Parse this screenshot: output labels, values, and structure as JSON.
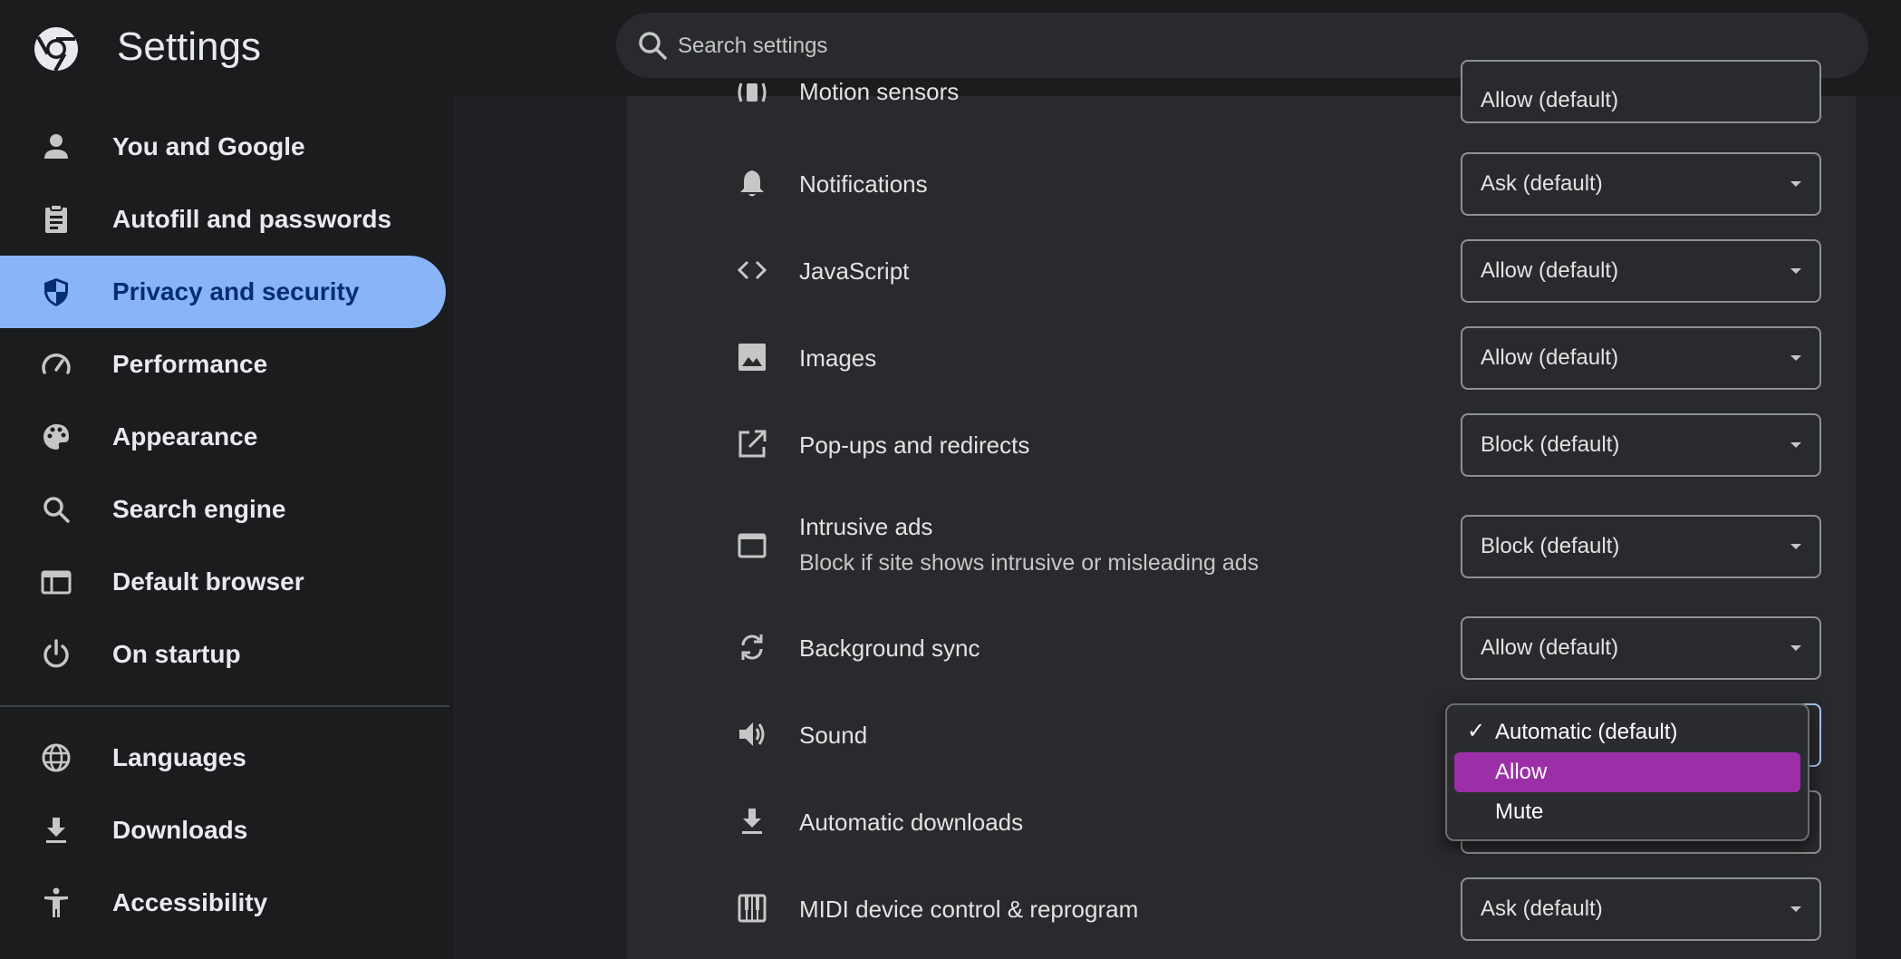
{
  "header": {
    "title": "Settings",
    "search_placeholder": "Search settings"
  },
  "sidebar": {
    "items": [
      {
        "label": "You and Google",
        "icon": "person-icon"
      },
      {
        "label": "Autofill and passwords",
        "icon": "clipboard-icon"
      },
      {
        "label": "Privacy and security",
        "icon": "shield-icon",
        "active": true
      },
      {
        "label": "Performance",
        "icon": "speedometer-icon"
      },
      {
        "label": "Appearance",
        "icon": "palette-icon"
      },
      {
        "label": "Search engine",
        "icon": "search-icon"
      },
      {
        "label": "Default browser",
        "icon": "browser-window-icon"
      },
      {
        "label": "On startup",
        "icon": "power-icon"
      },
      {
        "label": "Languages",
        "icon": "globe-icon"
      },
      {
        "label": "Downloads",
        "icon": "download-icon"
      },
      {
        "label": "Accessibility",
        "icon": "accessibility-icon"
      }
    ]
  },
  "content": {
    "rows": [
      {
        "label": "Motion sensors",
        "value": "Allow (default)",
        "icon": "motion-sensor-icon"
      },
      {
        "label": "Notifications",
        "value": "Ask (default)",
        "icon": "bell-icon"
      },
      {
        "label": "JavaScript",
        "value": "Allow (default)",
        "icon": "code-icon"
      },
      {
        "label": "Images",
        "value": "Allow (default)",
        "icon": "image-icon"
      },
      {
        "label": "Pop-ups and redirects",
        "value": "Block (default)",
        "icon": "external-link-icon"
      },
      {
        "label": "Intrusive ads",
        "sublabel": "Block if site shows intrusive or misleading ads",
        "value": "Block (default)",
        "icon": "window-icon"
      },
      {
        "label": "Background sync",
        "value": "Allow (default)",
        "icon": "sync-icon"
      },
      {
        "label": "Sound",
        "value": "Automatic (default)",
        "icon": "speaker-icon"
      },
      {
        "label": "Automatic downloads",
        "value": "",
        "icon": "download-icon"
      },
      {
        "label": "MIDI device control & reprogram",
        "value": "Ask (default)",
        "icon": "piano-icon"
      }
    ],
    "sound_dropdown": {
      "options": [
        "Automatic (default)",
        "Allow",
        "Mute"
      ],
      "checked": "Automatic (default)",
      "highlighted": "Allow",
      "check_mark": "✓"
    }
  },
  "colors": {
    "active_nav": "#8ab4f8",
    "highlight": "#9c2fa8",
    "background": "#202124"
  }
}
